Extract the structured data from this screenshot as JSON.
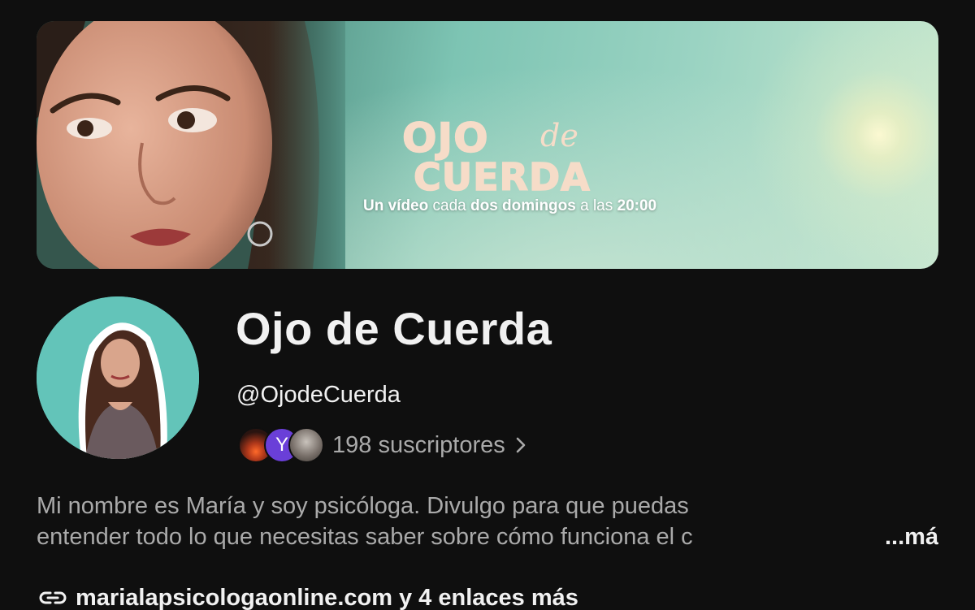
{
  "banner": {
    "logo_ojo": "OJO",
    "logo_de": "de",
    "logo_cuerda": "CUERDA",
    "tagline_parts": [
      "Un vídeo",
      " cada ",
      "dos domingos",
      " a las ",
      "20:00"
    ]
  },
  "channel": {
    "name": "Ojo de Cuerda",
    "handle": "@OjodeCuerda",
    "subscribers_text": "198 suscriptores",
    "subscriber_avatar_letter": "Y"
  },
  "description": {
    "line1": "Mi nombre es María y soy psicóloga. Divulgo para que puedas",
    "line2": "entender todo lo que necesitas saber sobre cómo funciona el c",
    "more_label": "...más"
  },
  "links": {
    "primary": "marialapsicologaonline.com",
    "more": "y 4 enlaces más"
  },
  "colors": {
    "background": "#0f0f0f",
    "text_primary": "#f1f1f1",
    "text_secondary": "#aaaaaa",
    "avatar_bg": "#63c4b9",
    "logo_color": "#f6dcc8"
  }
}
